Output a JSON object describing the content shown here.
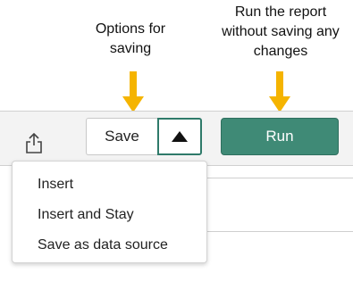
{
  "annotations": {
    "save_options": "Options for\nsaving",
    "run_report": "Run the report\nwithout saving any\nchanges"
  },
  "toolbar": {
    "share_icon": "share-export-icon",
    "save_label": "Save",
    "save_options_icon": "caret-up-icon",
    "run_label": "Run"
  },
  "save_menu": {
    "items": [
      "Insert",
      "Insert and Stay",
      "Save as data source"
    ]
  },
  "colors": {
    "arrow": "#f5b400",
    "run_button": "#3f8a76",
    "save_options_border": "#2f7a6a"
  }
}
